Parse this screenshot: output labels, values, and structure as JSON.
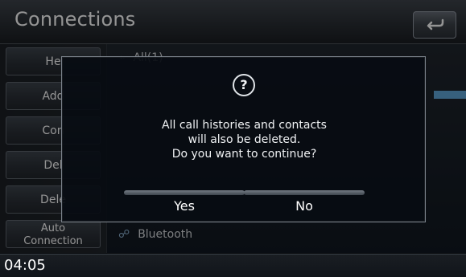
{
  "app": {
    "title": "Connections",
    "clock": "04:05"
  },
  "sidebar": {
    "items": [
      {
        "label": "He"
      },
      {
        "label": "Add"
      },
      {
        "label": "Con"
      },
      {
        "label": "Del"
      },
      {
        "label": "Dele"
      },
      {
        "label": "Auto\nConnection"
      }
    ]
  },
  "content": {
    "header": "All(1)"
  },
  "dialog": {
    "icon": "question-icon",
    "message_lines": [
      "All call histories and contacts",
      "will also be deleted.",
      "Do you want to continue?"
    ],
    "buttons": [
      {
        "label": "Yes"
      },
      {
        "label": "No"
      }
    ]
  },
  "icons": {
    "back": "back-arrow-icon"
  }
}
